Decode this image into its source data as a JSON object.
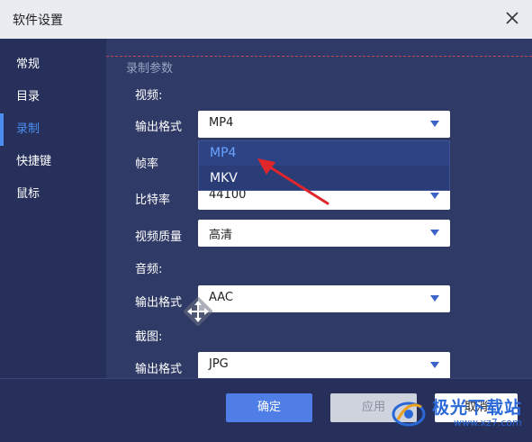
{
  "window": {
    "title": "软件设置"
  },
  "sidebar": {
    "items": [
      {
        "label": "常规"
      },
      {
        "label": "目录"
      },
      {
        "label": "录制"
      },
      {
        "label": "快捷键"
      },
      {
        "label": "鼠标"
      }
    ],
    "active_index": 2
  },
  "content": {
    "section_title": "录制参数",
    "video": {
      "group_label": "视频:",
      "output_format_label": "输出格式",
      "output_format_value": "MP4",
      "frame_rate_label": "帧率",
      "bitrate_label": "比特率",
      "bitrate_value": "44100",
      "quality_label": "视频质量",
      "quality_value": "高清"
    },
    "audio": {
      "group_label": "音频:",
      "output_format_label": "输出格式",
      "output_format_value": "AAC"
    },
    "screenshot": {
      "group_label": "截图:",
      "output_format_label": "输出格式",
      "output_format_value": "JPG"
    },
    "dropdown_options": [
      "MP4",
      "MKV"
    ]
  },
  "footer": {
    "ok_label": "确定",
    "apply_label": "应用",
    "cancel_label": "取消"
  },
  "watermark": {
    "text": "极光下载站",
    "url": "www.xz7.com"
  },
  "colors": {
    "accent": "#4b8ef0",
    "annotation_arrow": "#e0262b"
  }
}
